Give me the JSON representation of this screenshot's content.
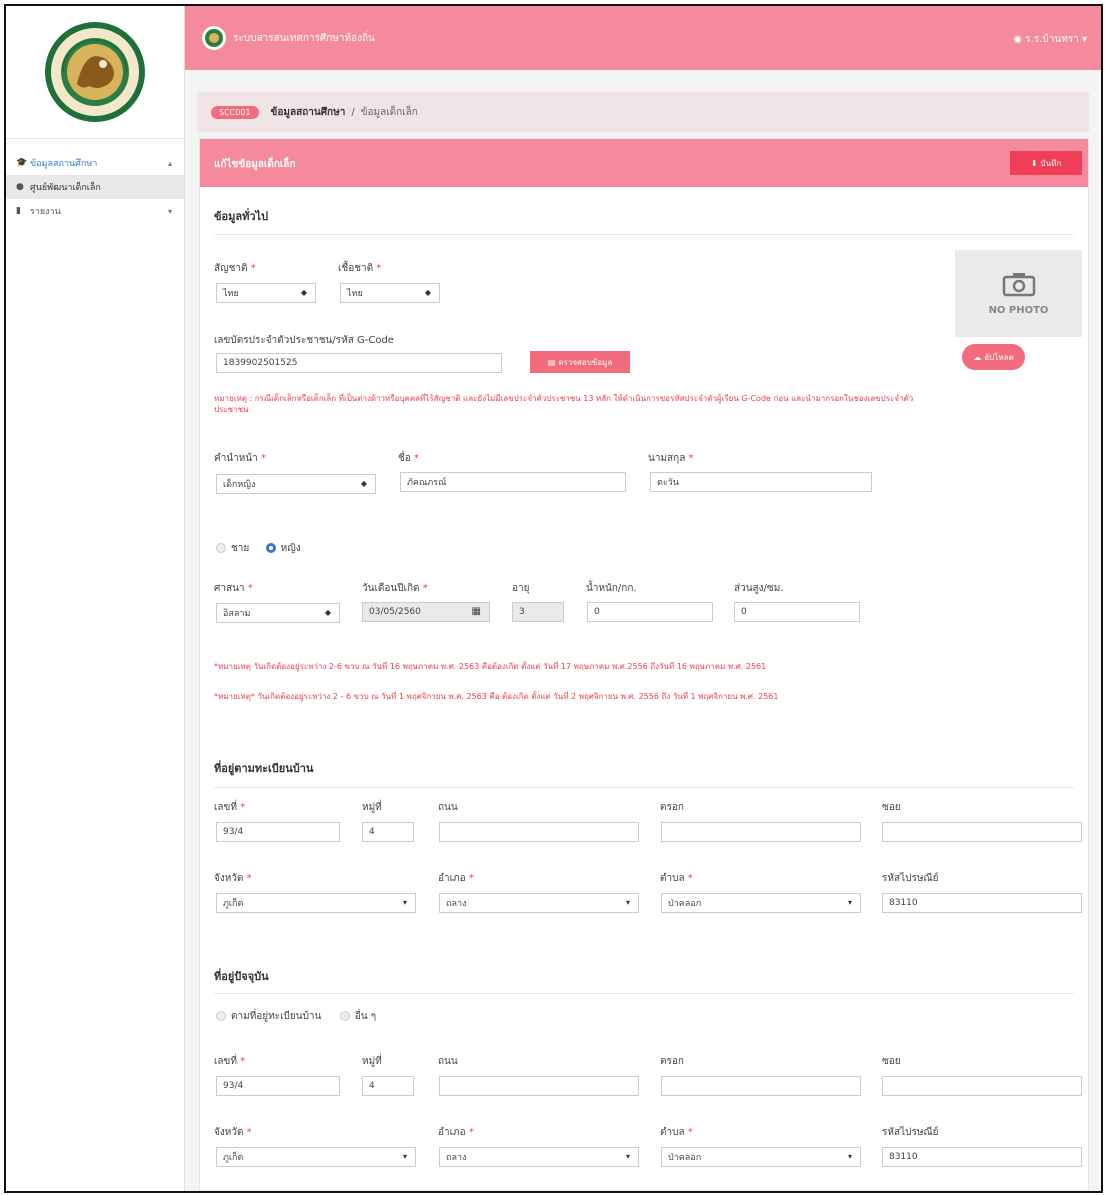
{
  "app": {
    "title": "ระบบสารสนเทศการศึกษาท้องถิ่น",
    "user": "ร.ร.บ้านทรา"
  },
  "sidebar": {
    "items": [
      {
        "label": "ข้อมูลสถานศึกษา",
        "icon": "graduation-cap-icon"
      },
      {
        "label": "ศูนย์พัฒนาเด็กเล็ก",
        "icon": "circle-icon"
      },
      {
        "label": "รายงาน",
        "icon": "file-icon"
      }
    ]
  },
  "breadcrumb": {
    "code": "SCC001",
    "main": "ข้อมูลสถานศึกษา",
    "sep": "/",
    "current": "ข้อมูลเด็กเล็ก"
  },
  "card": {
    "title": "แก้ไขข้อมูลเด็กเล็ก",
    "save": "บันทึก"
  },
  "general": {
    "title": "ข้อมูลทั่วไป",
    "nationality_label": "สัญชาติ",
    "nationality": "ไทย",
    "race_label": "เชื้อชาติ",
    "race": "ไทย",
    "id_label": "เลขบัตรประจำตัวประชาชน/รหัส G-Code",
    "id_value": "1839902501525",
    "check_button": "ตรวจสอบข้อมูล",
    "photo_text": "NO PHOTO",
    "upload_button": "อัปโหลด",
    "id_note": "หมายเหตุ : กรณีเด็กเล็กหรือเด็กเล็ก ที่เป็นต่างด้าวหรือบุคคลที่ไร้สัญชาติ และยังไม่มีเลขประจำตัวประชาชน 13 หลัก ให้ดำเนินการขอรหัสประจำตัวผู้เรียน G-Code ก่อน และนำมากรอกในช่องเลขประจำตัวประชาชน",
    "prefix_label": "คำนำหน้า",
    "prefix": "เด็กหญิง",
    "firstname_label": "ชื่อ",
    "firstname": "ภัคณภรณ์",
    "lastname_label": "นามสกุล",
    "lastname": "ตะวัน",
    "male_label": "ชาย",
    "female_label": "หญิง",
    "religion_label": "ศาสนา",
    "religion": "อิสลาม",
    "birth_label": "วันเดือนปีเกิด",
    "birth": "03/05/2560",
    "age_label": "อายุ",
    "age": "3",
    "weight_label": "น้ำหนัก/กก.",
    "weight": "0",
    "height_label": "ส่วนสูง/ซม.",
    "height": "0",
    "note1": "*หมายเหตุ วันเกิดต้องอยู่ระหว่าง 2-6 ขวบ ณ วันที่ 16 พฤษภาคม พ.ศ. 2563 คือต้องเกิด ตั้งแต่ วันที่ 17 พฤษภาคม พ.ศ.2556 ถึงวันที่ 16 พฤษภาคม พ.ศ. 2561",
    "note2": "*หมายเหตุ* วันเกิดต้องอยู่ระหว่าง 2 - 6 ขวบ ณ วันที่ 1 พฤศจิกายน พ.ศ. 2563 คือ ต้องเกิด ตั้งแต่ วันที่ 2 พฤศจิกายน พ.ศ. 2556 ถึง วันที่ 1 พฤศจิกายน พ.ศ. 2561"
  },
  "reg_address": {
    "title": "ที่อยู่ตามทะเบียนบ้าน",
    "no_label": "เลขที่",
    "no": "93/4",
    "moo_label": "หมู่ที่",
    "moo": "4",
    "road_label": "ถนน",
    "road": "",
    "alley_label": "ตรอก",
    "alley": "",
    "soi_label": "ซอย",
    "soi": "",
    "province_label": "จังหวัด",
    "province": "ภูเก็ต",
    "district_label": "อำเภอ",
    "district": "ถลาง",
    "subdistrict_label": "ตำบล",
    "subdistrict": "ป่าคลอก",
    "postcode_label": "รหัสไปรษณีย์",
    "postcode": "83110"
  },
  "cur_address": {
    "title": "ที่อยู่ปัจจุบัน",
    "opt_same": "ตามที่อยู่ทะเบียนบ้าน",
    "opt_other": "อื่น ๆ",
    "no_label": "เลขที่",
    "no": "93/4",
    "moo_label": "หมู่ที่",
    "moo": "4",
    "road_label": "ถนน",
    "road": "",
    "alley_label": "ตรอก",
    "alley": "",
    "soi_label": "ซอย",
    "soi": "",
    "province_label": "จังหวัด",
    "province": "ภูเก็ต",
    "district_label": "อำเภอ",
    "district": "ถลาง",
    "subdistrict_label": "ตำบล",
    "subdistrict": "ป่าคลอก",
    "postcode_label": "รหัสไปรษณีย์",
    "postcode": "83110"
  },
  "colors": {
    "accent": "#f48a9b",
    "danger": "#ef3e55",
    "primary": "#3a78d6"
  }
}
